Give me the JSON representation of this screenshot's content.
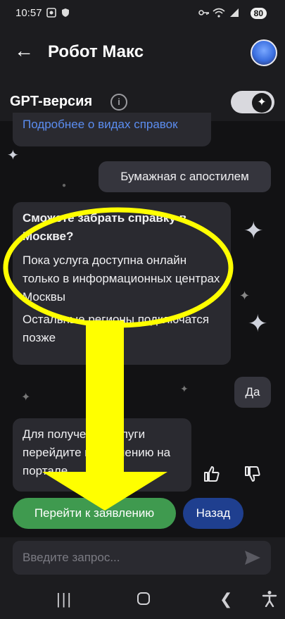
{
  "status_bar": {
    "time": "10:57",
    "battery": "80"
  },
  "header": {
    "title": "Робот Макс"
  },
  "gpt": {
    "label": "GPT-версия",
    "toggle_on": true
  },
  "chat": {
    "partial_link": "Подробнее о видах справок",
    "user_msg_1": "Бумажная с апостилем",
    "bot_msg_1": {
      "question": "Сможете забрать справку в Москве?",
      "answer": "Пока услуга доступна онлайн только в информационных центрах Москвы",
      "note": "Остальные регионы подключатся позже"
    },
    "user_msg_2": "Да",
    "bot_msg_2": "Для получения услуги перейдите к заявлению на портале"
  },
  "actions": {
    "go_label": "Перейти к заявлению",
    "back_label": "Назад"
  },
  "input": {
    "placeholder": "Введите запрос..."
  },
  "colors": {
    "annotation": "#ffff00",
    "go_button": "#3f9a4f",
    "back_button": "#1f3f8f"
  }
}
